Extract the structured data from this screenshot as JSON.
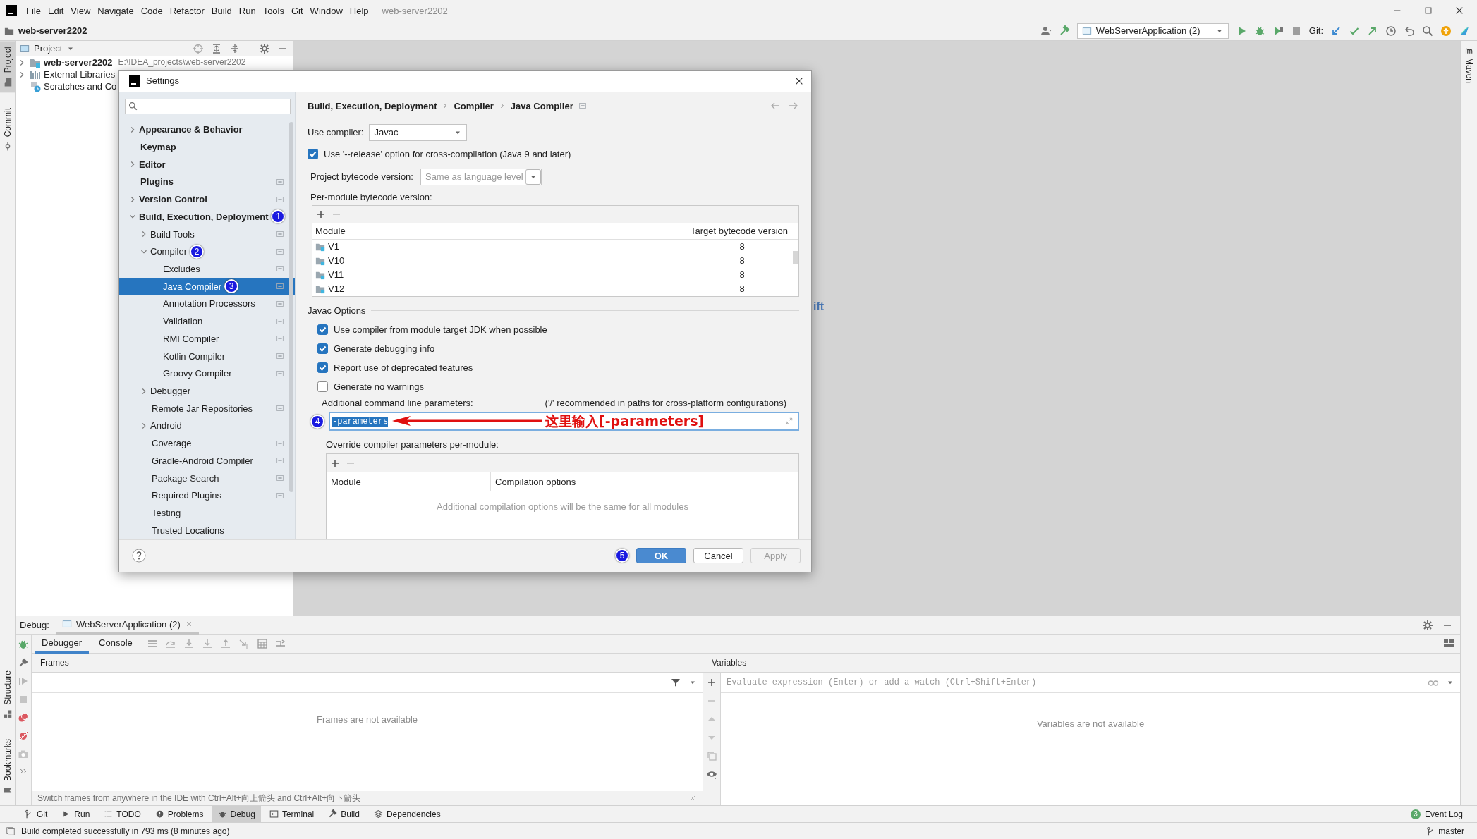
{
  "menu_bar": {
    "items": [
      "File",
      "Edit",
      "View",
      "Navigate",
      "Code",
      "Refactor",
      "Build",
      "Run",
      "Tools",
      "Git",
      "Window",
      "Help"
    ],
    "title": "web-server2202"
  },
  "nav_bar": {
    "project": "web-server2202",
    "run_config": "WebServerApplication (2)",
    "git_label": "Git:"
  },
  "tool_stripes": {
    "left_top": [
      {
        "label": "Project",
        "selected": true
      },
      {
        "label": "Commit",
        "selected": false
      }
    ],
    "left_bottom": [
      {
        "label": "Structure",
        "selected": false
      },
      {
        "label": "Bookmarks",
        "selected": false
      }
    ],
    "right": [
      {
        "label": "Maven",
        "selected": false
      }
    ]
  },
  "project_panel": {
    "title": "Project",
    "tree": [
      {
        "label": "web-server2202",
        "path": "E:\\IDEA_projects\\web-server2202",
        "kind": "module",
        "expanded": false
      },
      {
        "label": "External Libraries",
        "kind": "libraries",
        "expanded": false
      },
      {
        "label": "Scratches and Co",
        "kind": "scratches"
      }
    ]
  },
  "editor": {
    "hint": "ift"
  },
  "settings_dialog": {
    "title": "Settings",
    "sidebar": [
      {
        "label": "Appearance & Behavior",
        "expanded": false,
        "project_level": false,
        "selected": false
      },
      {
        "label": "Keymap",
        "project_level": false,
        "selected": false
      },
      {
        "label": "Editor",
        "expanded": false,
        "project_level": false,
        "selected": false
      },
      {
        "label": "Plugins",
        "project_level": true,
        "selected": false
      },
      {
        "label": "Version Control",
        "expanded": false,
        "project_level": true,
        "selected": false
      },
      {
        "label": "Build, Execution, Deployment",
        "expanded": true,
        "project_level": false,
        "selected": false,
        "badge": "1",
        "children": [
          {
            "label": "Build Tools",
            "expanded": false,
            "project_level": true,
            "selected": false
          },
          {
            "label": "Compiler",
            "expanded": true,
            "project_level": true,
            "selected": false,
            "badge": "2",
            "children": [
              {
                "label": "Excludes",
                "project_level": true,
                "selected": false
              },
              {
                "label": "Java Compiler",
                "project_level": true,
                "selected": true,
                "badge": "3"
              },
              {
                "label": "Annotation Processors",
                "project_level": true,
                "selected": false
              },
              {
                "label": "Validation",
                "project_level": true,
                "selected": false
              },
              {
                "label": "RMI Compiler",
                "project_level": true,
                "selected": false
              },
              {
                "label": "Kotlin Compiler",
                "project_level": true,
                "selected": false
              },
              {
                "label": "Groovy Compiler",
                "project_level": true,
                "selected": false
              }
            ]
          },
          {
            "label": "Debugger",
            "expanded": false,
            "project_level": false,
            "selected": false
          },
          {
            "label": "Remote Jar Repositories",
            "project_level": true,
            "selected": false
          },
          {
            "label": "Android",
            "expanded": false,
            "project_level": false,
            "selected": false
          },
          {
            "label": "Coverage",
            "project_level": true,
            "selected": false
          },
          {
            "label": "Gradle-Android Compiler",
            "project_level": true,
            "selected": false
          },
          {
            "label": "Package Search",
            "project_level": true,
            "selected": false
          },
          {
            "label": "Required Plugins",
            "project_level": true,
            "selected": false
          },
          {
            "label": "Testing",
            "project_level": false,
            "selected": false
          },
          {
            "label": "Trusted Locations",
            "project_level": false,
            "selected": false
          }
        ]
      }
    ],
    "page": {
      "breadcrumb": [
        "Build, Execution, Deployment",
        "Compiler",
        "Java Compiler"
      ],
      "use_compiler": {
        "label": "Use compiler:",
        "value": "Javac"
      },
      "release_option": {
        "label": "Use '--release' option for cross-compilation (Java 9 and later)",
        "checked": true
      },
      "project_bytecode": {
        "label": "Project bytecode version:",
        "placeholder": "Same as language level"
      },
      "per_module": {
        "label": "Per-module bytecode version:",
        "columns": [
          "Module",
          "Target bytecode version"
        ],
        "rows": [
          {
            "module": "V1",
            "target": "8"
          },
          {
            "module": "V10",
            "target": "8"
          },
          {
            "module": "V11",
            "target": "8"
          },
          {
            "module": "V12",
            "target": "8"
          }
        ]
      },
      "javac_options": {
        "title": "Javac Options",
        "options": [
          {
            "label": "Use compiler from module target JDK when possible",
            "checked": true
          },
          {
            "label": "Generate debugging info",
            "checked": true
          },
          {
            "label": "Report use of deprecated features",
            "checked": true
          },
          {
            "label": "Generate no warnings",
            "checked": false
          }
        ],
        "params_label": "Additional command line parameters:",
        "params_hint": "('/' recommended in paths for cross-platform configurations)",
        "params_value": "-parameters",
        "value_selected": true,
        "params_badge": "4",
        "annotation": "这里输入[-parameters]",
        "override_label": "Override compiler parameters per-module:",
        "override_columns": [
          "Module",
          "Compilation options"
        ],
        "override_empty": "Additional compilation options will be the same for all modules"
      }
    },
    "buttons": [
      {
        "label": "OK",
        "kind": "primary",
        "badge": "5",
        "disabled": false
      },
      {
        "label": "Cancel",
        "kind": "normal",
        "disabled": false
      },
      {
        "label": "Apply",
        "kind": "normal",
        "disabled": true
      }
    ]
  },
  "debug_panel": {
    "label": "Debug:",
    "session_tab": "WebServerApplication (2)",
    "tabs": [
      {
        "label": "Debugger",
        "selected": true
      },
      {
        "label": "Console",
        "selected": false
      }
    ],
    "frames": {
      "title": "Frames",
      "empty": "Frames are not available",
      "hint": "Switch frames from anywhere in the IDE with Ctrl+Alt+向上箭头 and Ctrl+Alt+向下箭头"
    },
    "variables": {
      "title": "Variables",
      "placeholder": "Evaluate expression (Enter) or add a watch (Ctrl+Shift+Enter)",
      "empty": "Variables are not available"
    }
  },
  "tool_window_bar": {
    "items": [
      {
        "label": "Git",
        "kind": "git",
        "selected": false
      },
      {
        "label": "Run",
        "kind": "run",
        "selected": false
      },
      {
        "label": "TODO",
        "kind": "todo",
        "selected": false
      },
      {
        "label": "Problems",
        "kind": "problems",
        "selected": false
      },
      {
        "label": "Debug",
        "kind": "debug",
        "selected": true
      },
      {
        "label": "Terminal",
        "kind": "terminal",
        "selected": false
      },
      {
        "label": "Build",
        "kind": "build",
        "selected": false
      },
      {
        "label": "Dependencies",
        "kind": "dependencies",
        "selected": false
      }
    ],
    "event_log": {
      "count": "3",
      "label": "Event Log"
    }
  },
  "status_bar": {
    "message": "Build completed successfully in 793 ms (8 minutes ago)",
    "branch": "master"
  }
}
